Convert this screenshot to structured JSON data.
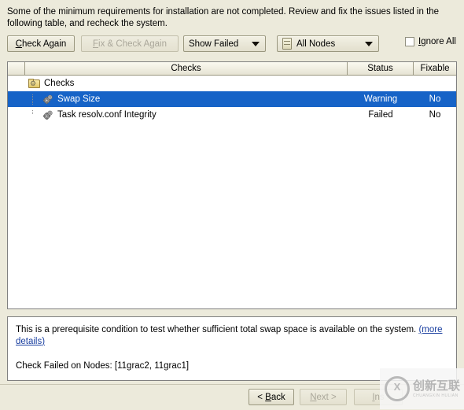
{
  "intro": {
    "message": "Some of the minimum requirements for installation are not completed. Review and fix the issues listed in the following table, and recheck the system."
  },
  "toolbar": {
    "check_again_label": "Check Again",
    "check_again_mnemonic": "C",
    "fix_check_again_label": "Fix & Check Again",
    "fix_check_again_mnemonic": "F",
    "show_filter_value": "Show Failed",
    "nodes_filter_value": "All Nodes",
    "nodes_icon": "server-node-icon",
    "ignore_all_label": "Ignore All",
    "ignore_all_mnemonic": "I",
    "ignore_all_checked": false
  },
  "table": {
    "columns": [
      "",
      "Checks",
      "Status",
      "Fixable"
    ],
    "root": {
      "label": "Checks",
      "icon": "checks-folder-icon"
    },
    "rows": [
      {
        "name": "Swap Size",
        "status": "Warning",
        "fixable": "No",
        "icon": "gear-icon",
        "selected": true
      },
      {
        "name": "Task resolv.conf Integrity",
        "status": "Failed",
        "fixable": "No",
        "icon": "gear-icon",
        "selected": false
      }
    ]
  },
  "details": {
    "description_lead": "This is a prerequisite condition to test whether sufficient total swap space is available on the system. ",
    "more_details_link": "(more details)",
    "failed_nodes_text": "Check Failed on Nodes: [11grac2, 11grac1]"
  },
  "footer": {
    "back_label": "< Back",
    "back_mnemonic": "B",
    "next_label": "Next >",
    "next_mnemonic": "N",
    "install_label": "Ins",
    "install_mnemonic": "I"
  },
  "watermark": {
    "cn_text": "创新互联",
    "en_text": "CHUANGXIN HULIAN"
  },
  "colors": {
    "window_background": "#eceadb",
    "selection_blue": "#1663c7",
    "panel_white": "#ffffff",
    "link_blue": "#1a3fa0",
    "border_gray": "#808080"
  }
}
